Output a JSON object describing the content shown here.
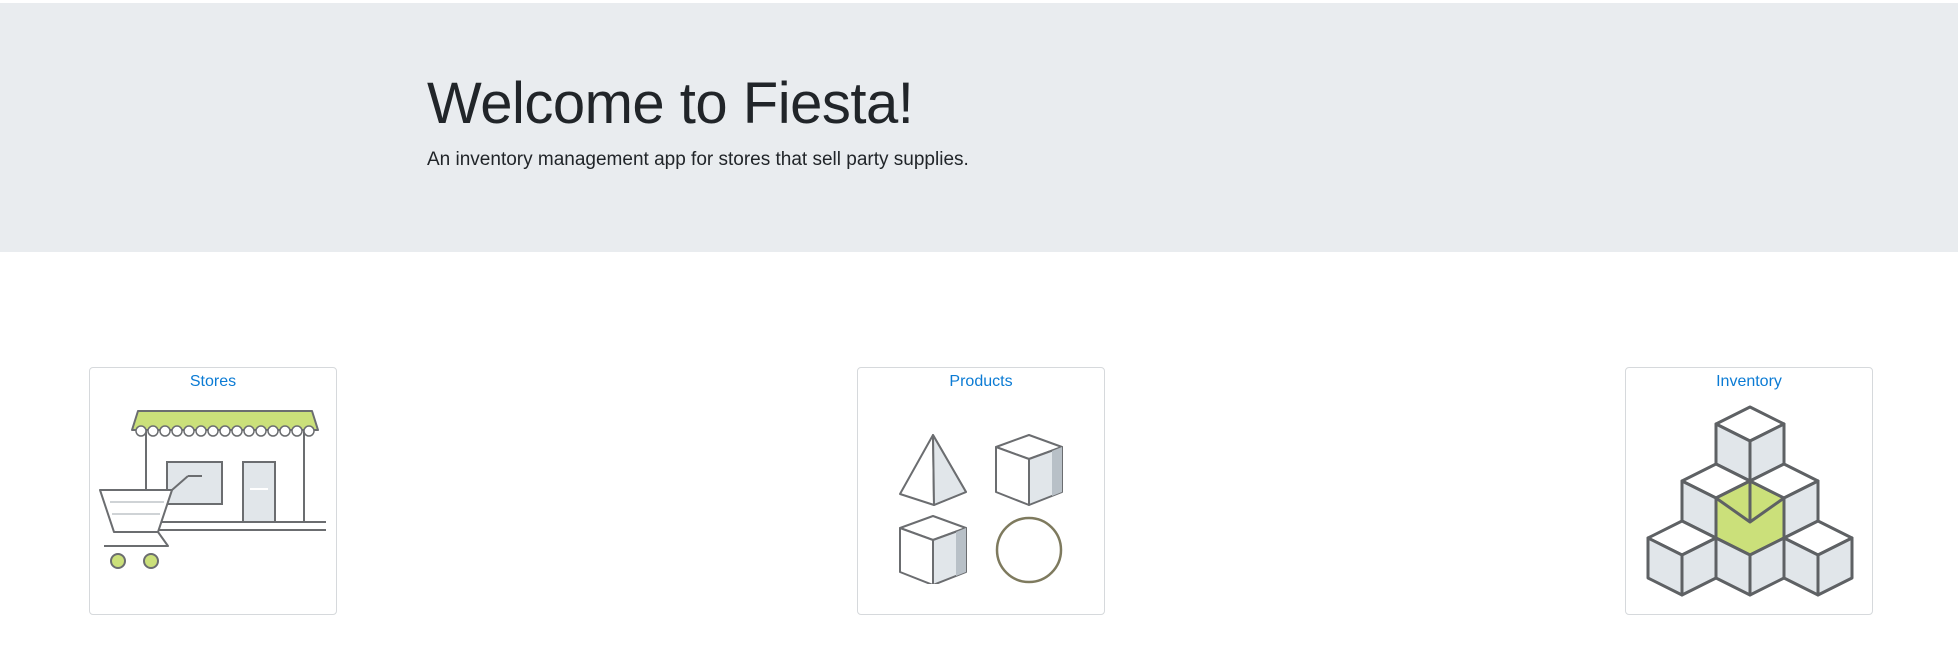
{
  "header": {
    "title": "Welcome to Fiesta!",
    "subtitle": "An inventory management app for stores that sell party supplies."
  },
  "cards": [
    {
      "label": "Stores",
      "icon": "storefront-with-cart-icon"
    },
    {
      "label": "Products",
      "icon": "product-shapes-icon"
    },
    {
      "label": "Inventory",
      "icon": "stacked-cubes-icon"
    }
  ],
  "colors": {
    "jumbotron_bg": "#e9ecef",
    "link": "#0b7bd4",
    "accent_green": "#cbe07a",
    "icon_stroke": "#6b6d70",
    "icon_fill": "#e1e6ea"
  }
}
